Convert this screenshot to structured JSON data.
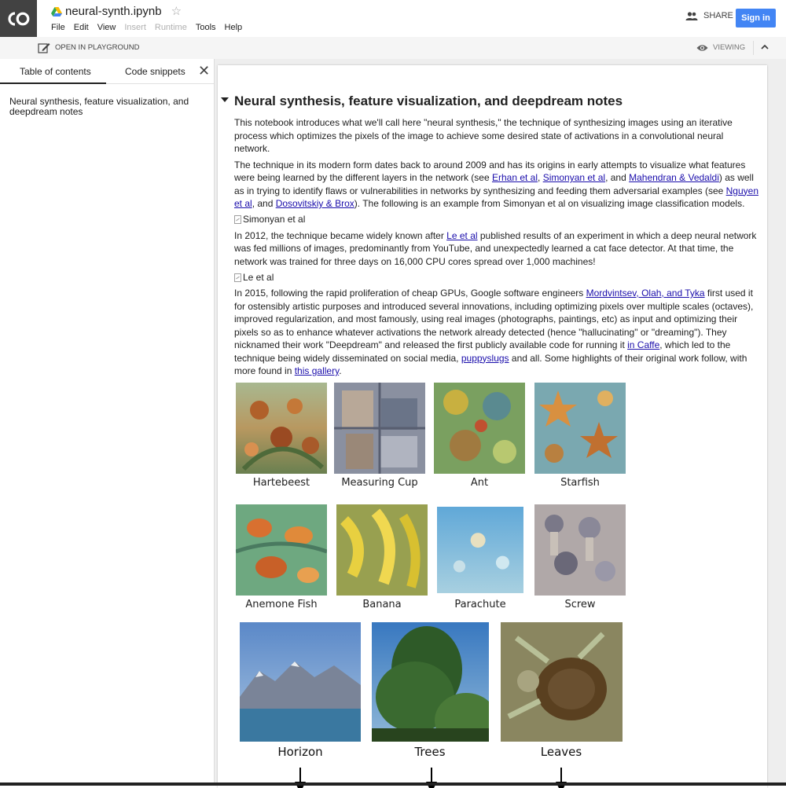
{
  "app": {
    "logo_text": "CO",
    "notebook_title": "neural-synth.ipynb"
  },
  "menu": [
    "File",
    "Edit",
    "View",
    "Insert",
    "Runtime",
    "Tools",
    "Help"
  ],
  "header": {
    "share_label": "SHARE",
    "signin_label": "Sign in"
  },
  "toolbar": {
    "playground_label": "OPEN IN PLAYGROUND",
    "viewing_label": "VIEWING"
  },
  "sidebar": {
    "tabs": [
      "Table of contents",
      "Code snippets"
    ],
    "toc": [
      "Neural synthesis, feature visualization, and deepdream notes"
    ]
  },
  "notebook": {
    "heading": "Neural synthesis, feature visualization, and deepdream notes",
    "p1": "This notebook introduces what we'll call here \"neural synthesis,\" the technique of synthesizing images using an iterative process which optimizes the pixels of the image to achieve some desired state of activations in a convolutional neural network.",
    "p2": {
      "t1": "The technique in its modern form dates back to around 2009 and has its origins in early attempts to visualize what features were being learned by the different layers in the network (see ",
      "l1": "Erhan et al",
      "t2": ", ",
      "l2": "Simonyan et al",
      "t3": ", and ",
      "l3": "Mahendran & Vedaldi",
      "t4": ") as well as in trying to identify flaws or vulnerabilities in networks by synthesizing and feeding them adversarial examples (see ",
      "l4": "Nguyen et al",
      "t5": ", and ",
      "l5": "Dosovitskiy & Brox",
      "t6": "). The following is an example from Simonyan et al on visualizing image classification models."
    },
    "img1_alt": "Simonyan et al",
    "p3": {
      "t1": "In 2012, the technique became widely known after ",
      "l1": "Le et al",
      "t2": " published results of an experiment in which a deep neural network was fed millions of images, predominantly from YouTube, and unexpectedly learned a cat face detector. At that time, the network was trained for three days on 16,000 CPU cores spread over 1,000 machines!"
    },
    "img2_alt": "Le et al",
    "p4": {
      "t1": "In 2015, following the rapid proliferation of cheap GPUs, Google software engineers ",
      "l1": "Mordvintsev, Olah, and Tyka",
      "t2": " first used it for ostensibly artistic purposes and introduced several innovations, including optimizing pixels over multiple scales (octaves), improved regularization, and most famously, using real images (photographs, paintings, etc) as input and optimizing their pixels so as to enhance whatever activations the network already detected (hence \"hallucinating\" or \"dreaming\"). They nicknamed their work \"Deepdream\" and released the first publicly available code for running it ",
      "l2": "in Caffe",
      "t3": ", which led to the technique being widely disseminated on social media, ",
      "l3": "puppyslugs",
      "t4": " and all. Some highlights of their original work follow, with more found in ",
      "l4": "this gallery",
      "t5": "."
    },
    "gallery_row1": [
      "Hartebeest",
      "Measuring Cup",
      "Ant",
      "Starfish"
    ],
    "gallery_row2": [
      "Anemone Fish",
      "Banana",
      "Parachute",
      "Screw"
    ],
    "gallery_row3": [
      "Horizon",
      "Trees",
      "Leaves"
    ]
  },
  "colors": {
    "link": "#1a0dab",
    "signin": "#4285f4",
    "logo_bg": "#424242"
  }
}
